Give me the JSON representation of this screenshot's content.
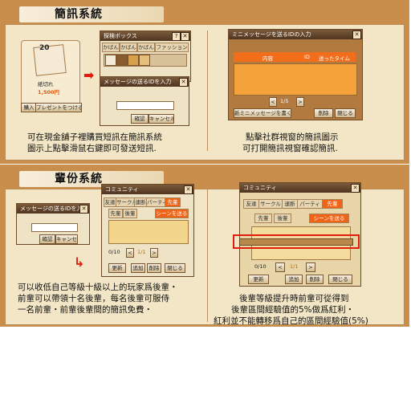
{
  "section1": {
    "title": "簡訊系統",
    "item_window": {
      "title": "探検ボックス",
      "tabs": [
        "かばん",
        "かばん",
        "かばん",
        "ファッション"
      ],
      "item_count": "20",
      "item_name": "紙切れ",
      "item_price": "1,500円",
      "buy_button": "購入",
      "present_button": "プレゼントをつける"
    },
    "id_window": {
      "title": "メッセージの送るIDを入力",
      "confirm": "確認",
      "cancel": "キャンセル"
    },
    "caption_left": [
      "可在現金舖子裡購買短訊在簡訊系統",
      "圖示上點擊滑鼠右鍵即可發送短訊."
    ],
    "list_window": {
      "title": "ミニメッセージを送るIDの入力",
      "col_content": "内容",
      "col_id": "ID",
      "col_time": "送ったタイム",
      "page": "1/5",
      "new_message": "新ミニメッセージを書く",
      "delete": "削除",
      "close": "閉じる"
    },
    "caption_right": [
      "點擊社群視窗的簡訊圖示",
      "可打開簡訊視窗確認簡訊."
    ]
  },
  "section2": {
    "title": "輩份系統",
    "id_window": {
      "title": "メッセージの送るIDを入力",
      "confirm": "確認",
      "cancel": "キャンセル"
    },
    "community_window": {
      "title": "コミュニティ",
      "tabs": [
        "友達",
        "サークル",
        "連断",
        "パーティ",
        "先輩"
      ],
      "subtabs": [
        "先輩",
        "後輩",
        "シーンを送る"
      ],
      "count": "0/10",
      "page": "1/1",
      "refresh": "更新",
      "add": "追加",
      "delete": "削除",
      "close": "閉じる"
    },
    "caption_left": [
      "可以收低自己等級十級以上的玩家爲後輩・",
      "前輩可以帶領十名後輩，每名後輩可服侍",
      "一名前輩・前輩後輩間的簡訊免費・"
    ],
    "community_window_large": {
      "title": "コミュニティ",
      "tabs": [
        "友達",
        "サークル",
        "連断",
        "パーティ",
        "先輩"
      ],
      "subtabs": [
        "先輩",
        "後輩",
        "シーンを送る"
      ],
      "count": "0/10",
      "page": "1/1",
      "refresh": "更新",
      "add": "追加",
      "delete": "削除",
      "close": "閉じる"
    },
    "caption_right": [
      "後輩等級提升時前輩可從得到",
      "後輩區間經驗值的5%做爲紅利・",
      "紅利並不能轉移爲自己的區間經驗值(5%)"
    ]
  },
  "colors": {
    "panel_brown": "#c98e4c",
    "paper": "#f3e6c6",
    "accent_orange": "#f06418",
    "highlight_red": "#e01d0c"
  }
}
